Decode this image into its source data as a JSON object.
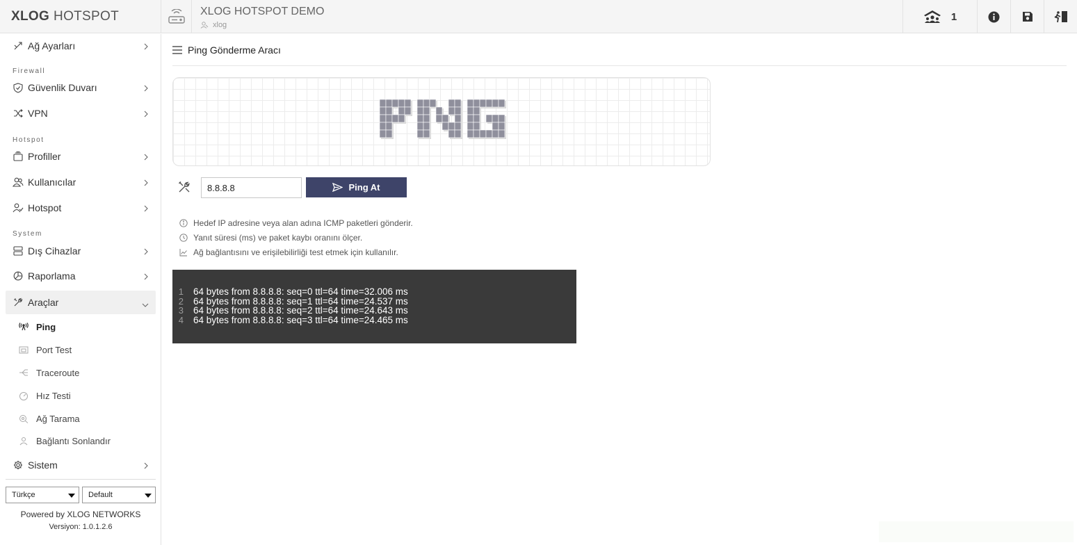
{
  "brand": {
    "bold": "XLOG",
    "rest": "HOTSPOT"
  },
  "header": {
    "title": "XLOG HOTSPOT DEMO",
    "user": "xlog",
    "active_users": "1"
  },
  "sidebar": {
    "top_item": "Ağ Ayarları",
    "section_firewall": "Firewall",
    "guvenlik": "Güvenlik Duvarı",
    "vpn": "VPN",
    "section_hotspot": "Hotspot",
    "profiller": "Profiller",
    "kullanicilar": "Kullanıcılar",
    "hotspot": "Hotspot",
    "section_system": "System",
    "dis_cihazlar": "Dış Cihazlar",
    "raporlama": "Raporlama",
    "araclar": "Araçlar",
    "sub_items": [
      "Ping",
      "Port Test",
      "Traceroute",
      "Hız Testi",
      "Ağ Tarama",
      "Bağlantı Sonlandır"
    ],
    "sistem": "Sistem",
    "language": "Türkçe",
    "theme": "Default",
    "powered": "Powered by XLOG NETWORKS",
    "version": "Versiyon: 1.0.1.2.6"
  },
  "main": {
    "page_title": "Ping Gönderme Aracı",
    "input_value": "8.8.8.8",
    "button_label": "Ping At",
    "info": [
      "Hedef IP adresine veya alan adına ICMP paketleri gönderir.",
      "Yanıt süresi (ms) ve paket kaybı oranını ölçer.",
      "Ağ bağlantısını ve erişilebilirliği test etmek için kullanılır."
    ],
    "output": [
      {
        "n": "1",
        "text": "64 bytes from 8.8.8.8: seq=0 ttl=64 time=32.006 ms"
      },
      {
        "n": "2",
        "text": "64 bytes from 8.8.8.8: seq=1 ttl=64 time=24.537 ms"
      },
      {
        "n": "3",
        "text": "64 bytes from 8.8.8.8: seq=2 ttl=64 time=24.643 ms"
      },
      {
        "n": "4",
        "text": "64 bytes from 8.8.8.8: seq=3 ttl=64 time=24.465 ms"
      }
    ]
  },
  "colors": {
    "accent": "#3e4469",
    "terminal_bg": "#3a3a3a"
  },
  "icons": [
    "router-icon",
    "users-icon",
    "info-icon",
    "save-icon",
    "logout-icon",
    "menu-icon",
    "tools-icon",
    "send-icon"
  ]
}
